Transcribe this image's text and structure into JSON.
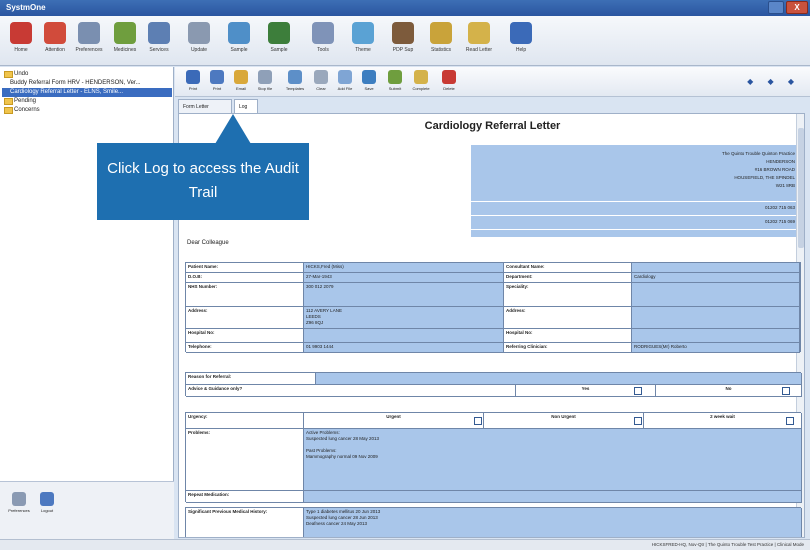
{
  "window": {
    "title": "SystmOne",
    "close_label": "X"
  },
  "toolbar": [
    {
      "label": "Home",
      "icon": "home-icon",
      "color": "#c83a34"
    },
    {
      "label": "Attention",
      "icon": "attention-icon",
      "color": "#d14b3b"
    },
    {
      "label": "Preferences",
      "icon": "preferences-icon",
      "color": "#7a8fb0"
    },
    {
      "label": "Medicines",
      "icon": "medicines-icon",
      "color": "#6f9e3e"
    },
    {
      "label": "Services",
      "icon": "services-icon",
      "color": "#5d7fb3"
    },
    {
      "label": "Update",
      "icon": "update-icon",
      "color": "#8a99b0"
    },
    {
      "label": "Sample",
      "icon": "sample-icon",
      "color": "#4f8fc8"
    },
    {
      "label": "Sample",
      "icon": "sample2-icon",
      "color": "#3d7e3b"
    },
    {
      "label": "Tools",
      "icon": "tools-icon",
      "color": "#7f93b8"
    },
    {
      "label": "Theme",
      "icon": "theme-icon",
      "color": "#5aa2d4"
    },
    {
      "label": "PDP Sup",
      "icon": "pdp-icon",
      "color": "#7d5b3c"
    },
    {
      "label": "Statistics",
      "icon": "statistics-icon",
      "color": "#c9a33a"
    },
    {
      "label": "Read Letter",
      "icon": "read-letter-icon",
      "color": "#d4b24a"
    },
    {
      "label": "Help",
      "icon": "help-icon",
      "color": "#3b6ab8"
    }
  ],
  "tree": [
    {
      "label": "Undo",
      "folder": true,
      "selected": false
    },
    {
      "label": "Buddy Referral Form HRV - HENDERSON, Ver...",
      "folder": false,
      "selected": false
    },
    {
      "label": "Cardiology Referral Letter - ELNS, Smile...",
      "folder": false,
      "selected": true
    },
    {
      "label": "Pending",
      "folder": true,
      "selected": false
    },
    {
      "label": "Concerns",
      "folder": true,
      "selected": false
    }
  ],
  "left_buttons": [
    {
      "label": "Preferences",
      "icon": "preferences-small-icon"
    },
    {
      "label": "Logout",
      "icon": "logout-icon"
    }
  ],
  "docbar": [
    {
      "label": "Print",
      "icon": "print-icon"
    },
    {
      "label": "Print",
      "icon": "print2-icon"
    },
    {
      "label": "Email",
      "icon": "email-icon"
    },
    {
      "label": "Stop file",
      "icon": "stop-icon"
    },
    {
      "label": "Templates",
      "icon": "templates-icon"
    },
    {
      "label": "Clear",
      "icon": "clear-icon"
    },
    {
      "label": "Add File",
      "icon": "add-file-icon"
    },
    {
      "label": "Save",
      "icon": "save-icon"
    },
    {
      "label": "Submit",
      "icon": "submit-icon"
    },
    {
      "label": "Complete",
      "icon": "complete-icon"
    },
    {
      "label": "Delete",
      "icon": "delete-icon"
    }
  ],
  "nav_arrows": "◆ ◆ ◆",
  "tabs": [
    {
      "label": "Form Letter",
      "active": false
    },
    {
      "label": "Log",
      "active": true
    }
  ],
  "document": {
    "title": "Cardiology Referral Letter",
    "address_lines": [
      "The Quinto Trouble Quinton Practice",
      "HENDERSON",
      "#16 BROWN ROAD",
      "HOUSEFIELD, THE SPINDEL",
      "W21 8RB"
    ],
    "phones": [
      "01202 715 063",
      "01202 715 069"
    ],
    "greeting": "Dear Colleague",
    "patient_rows": [
      {
        "l1": "Patient Name:",
        "v1": "HICKS,Fred (Miss)",
        "l2": "Consultant Name:",
        "v2": ""
      },
      {
        "l1": "D.O.B:",
        "v1": "27-Mar-1943",
        "l2": "Department:",
        "v2": "Cardiology"
      },
      {
        "l1": "NHS Number:",
        "v1": "300 012 2079",
        "l2": "Speciality:",
        "v2": ""
      },
      {
        "l1": "Address:",
        "v1": "112 AVERY LANE\nLEEDS\nZ96 8QJ",
        "l2": "Address:",
        "v2": ""
      },
      {
        "l1": "Hospital No:",
        "v1": "",
        "l2": "Hospital No:",
        "v2": ""
      },
      {
        "l1": "Telephone:",
        "v1": "01 9903 1444",
        "l2": "Referring Clinician:",
        "v2": "RODRIGUES(Mr) Roberto"
      }
    ],
    "reason_label": "Reason for Referral:",
    "advice_label": "Advice & Guidance only?",
    "yes_label": "Yes",
    "no_label": "No",
    "urgency_label": "Urgency:",
    "urgent_label": "Urgent",
    "non_urgent_label": "Non Urgent",
    "two_week_label": "2 week wait",
    "problems_label": "Problems:",
    "problems_text": "Active Problems:\nSuspected lung cancer 28 May 2013\n\nPast Problems:\nMammography normal 09 Nov 2009",
    "repeat_label": "Repeat Medication:",
    "history_label": "Significant Previous Medical History:",
    "history_text": "Type 1 diabetes mellitus 20 Jun 2013\nSuspected lung cancer 28 Jun 2013\nDeafness cancer 24 May 2013"
  },
  "status_text": "HICKSFRED-HQ, Nov-Qtr | The Quinto Trouble Test Practice | Clinical Mode",
  "callout": {
    "text": "Click Log to access the Audit Trail"
  }
}
